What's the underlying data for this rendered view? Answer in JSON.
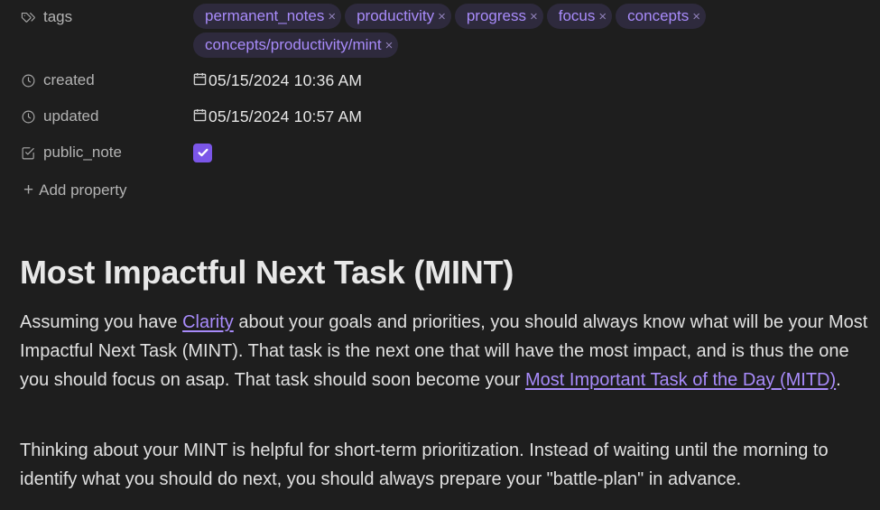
{
  "properties": {
    "tags": {
      "label": "tags",
      "values": [
        "permanent_notes",
        "productivity",
        "progress",
        "focus",
        "concepts",
        "concepts/productivity/mint"
      ],
      "remove_glyph": "×"
    },
    "created": {
      "label": "created",
      "value": "05/15/2024 10:36 AM"
    },
    "updated": {
      "label": "updated",
      "value": "05/15/2024 10:57 AM"
    },
    "public_note": {
      "label": "public_note",
      "checked": true
    },
    "add_property": {
      "plus": "+",
      "label": "Add property"
    }
  },
  "note": {
    "title": "Most Impactful Next Task (MINT)",
    "p1": {
      "t1": "Assuming you have ",
      "link1": "Clarity",
      "t2": " about your goals and priorities, you should always know what will be your Most Impactful Next Task (MINT). That task is the next one that will have the most impact, and is thus the one you should focus on asap. That task should soon become your ",
      "link2": "Most Important Task of the Day (MITD)",
      "t3": "."
    },
    "p2": "Thinking about your MINT is helpful for short-term prioritization. Instead of waiting until the morning to identify what you should do next, you should always prepare your \"battle-plan\" in advance."
  },
  "colors": {
    "background": "#1e1e1e",
    "accent": "#a88bfa",
    "tag_bg": "#2e2a3d",
    "checkbox": "#7b56e8"
  },
  "icons": {
    "tags": "tags-icon",
    "created": "clock-icon",
    "updated": "clock-icon",
    "public_note": "checkbox-square-icon",
    "date": "calendar-icon"
  }
}
